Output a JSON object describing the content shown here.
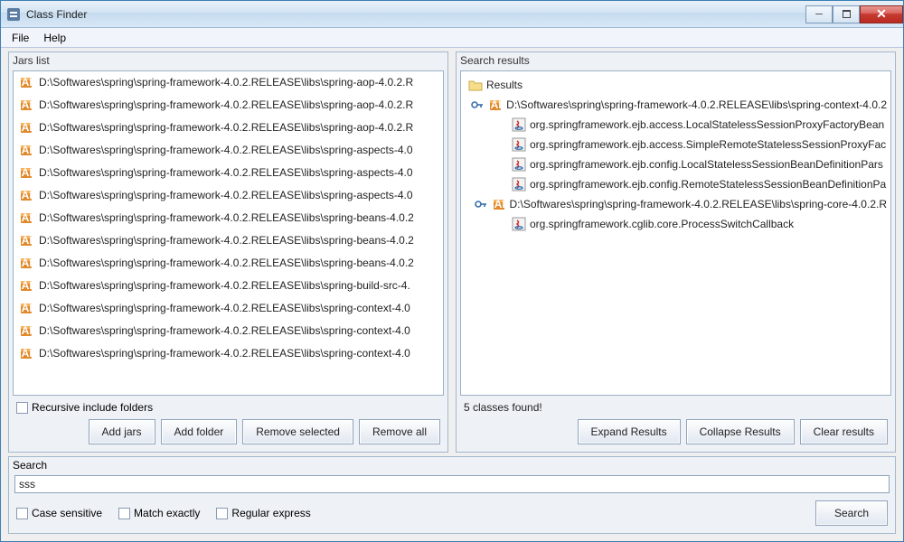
{
  "window": {
    "title": "Class Finder"
  },
  "menu": {
    "file": "File",
    "help": "Help"
  },
  "jars": {
    "title": "Jars list",
    "items": [
      "D:\\Softwares\\spring\\spring-framework-4.0.2.RELEASE\\libs\\spring-aop-4.0.2.R",
      "D:\\Softwares\\spring\\spring-framework-4.0.2.RELEASE\\libs\\spring-aop-4.0.2.R",
      "D:\\Softwares\\spring\\spring-framework-4.0.2.RELEASE\\libs\\spring-aop-4.0.2.R",
      "D:\\Softwares\\spring\\spring-framework-4.0.2.RELEASE\\libs\\spring-aspects-4.0",
      "D:\\Softwares\\spring\\spring-framework-4.0.2.RELEASE\\libs\\spring-aspects-4.0",
      "D:\\Softwares\\spring\\spring-framework-4.0.2.RELEASE\\libs\\spring-aspects-4.0",
      "D:\\Softwares\\spring\\spring-framework-4.0.2.RELEASE\\libs\\spring-beans-4.0.2",
      "D:\\Softwares\\spring\\spring-framework-4.0.2.RELEASE\\libs\\spring-beans-4.0.2",
      "D:\\Softwares\\spring\\spring-framework-4.0.2.RELEASE\\libs\\spring-beans-4.0.2",
      "D:\\Softwares\\spring\\spring-framework-4.0.2.RELEASE\\libs\\spring-build-src-4.",
      "D:\\Softwares\\spring\\spring-framework-4.0.2.RELEASE\\libs\\spring-context-4.0",
      "D:\\Softwares\\spring\\spring-framework-4.0.2.RELEASE\\libs\\spring-context-4.0",
      "D:\\Softwares\\spring\\spring-framework-4.0.2.RELEASE\\libs\\spring-context-4.0"
    ],
    "recursive_label": "Recursive include folders",
    "buttons": {
      "add_jars": "Add jars",
      "add_folder": "Add folder",
      "remove_selected": "Remove selected",
      "remove_all": "Remove all"
    }
  },
  "results": {
    "title": "Search results",
    "root_label": "Results",
    "groups": [
      {
        "jar": "D:\\Softwares\\spring\\spring-framework-4.0.2.RELEASE\\libs\\spring-context-4.0.2",
        "classes": [
          "org.springframework.ejb.access.LocalStatelessSessionProxyFactoryBean",
          "org.springframework.ejb.access.SimpleRemoteStatelessSessionProxyFac",
          "org.springframework.ejb.config.LocalStatelessSessionBeanDefinitionPars",
          "org.springframework.ejb.config.RemoteStatelessSessionBeanDefinitionPa"
        ]
      },
      {
        "jar": "D:\\Softwares\\spring\\spring-framework-4.0.2.RELEASE\\libs\\spring-core-4.0.2.R",
        "classes": [
          "org.springframework.cglib.core.ProcessSwitchCallback"
        ]
      }
    ],
    "status": "5 classes found!",
    "buttons": {
      "expand": "Expand Results",
      "collapse": "Collapse Results",
      "clear": "Clear results"
    }
  },
  "search": {
    "title": "Search",
    "value": "sss",
    "case_label": "Case sensitive",
    "match_label": "Match exactly",
    "regex_label": "Regular express",
    "search_button": "Search"
  }
}
